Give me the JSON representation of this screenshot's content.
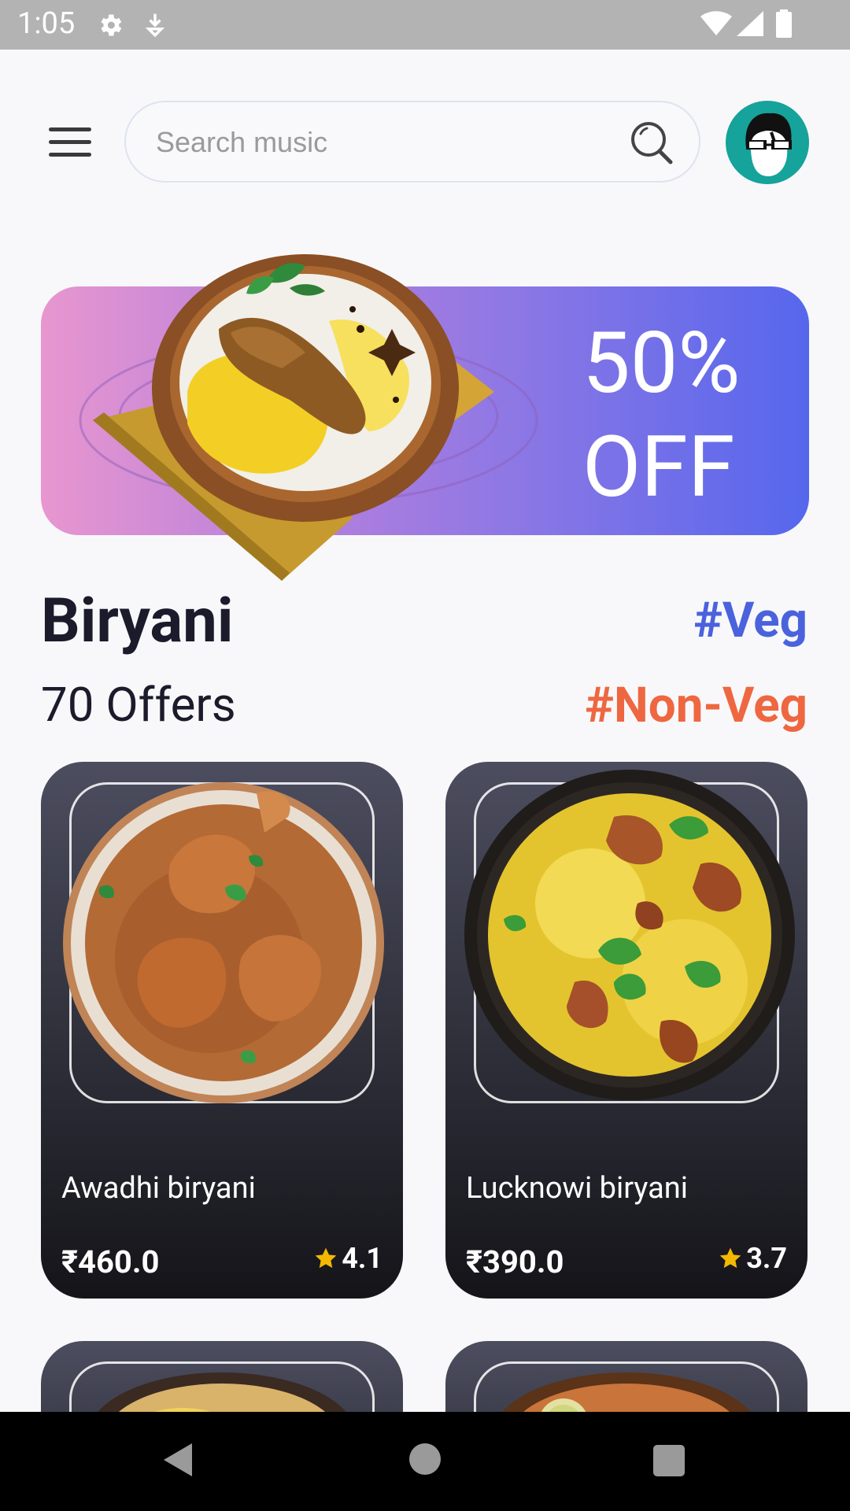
{
  "status_bar": {
    "time": "1:05"
  },
  "header": {
    "search_placeholder": "Search music"
  },
  "banner": {
    "discount_line1": "50%",
    "discount_line2": "OFF"
  },
  "category": {
    "title": "Biryani",
    "offers": "70 Offers",
    "tags": [
      "#Veg",
      "#Non-Veg"
    ]
  },
  "items": [
    {
      "name": "Awadhi biryani",
      "price": "₹460.0",
      "rating": "4.1"
    },
    {
      "name": "Lucknowi biryani",
      "price": "₹390.0",
      "rating": "3.7"
    }
  ],
  "colors": {
    "veg_tag": "#4b62dd",
    "nonveg_tag": "#ee6741",
    "avatar_bg": "#15a39b",
    "star": "#f5b800"
  }
}
